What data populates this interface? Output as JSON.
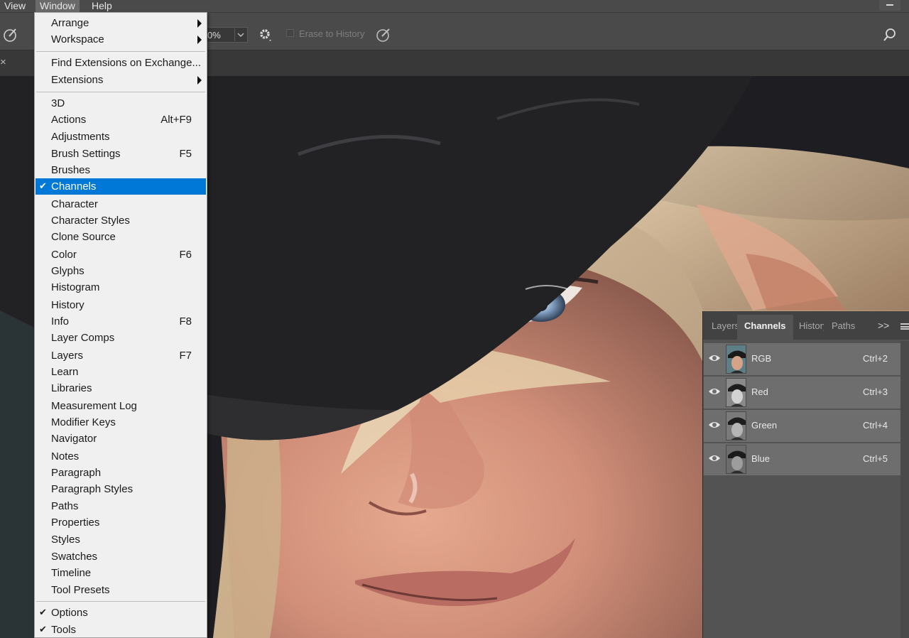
{
  "menubar": {
    "view": "View",
    "window": "Window",
    "help": "Help"
  },
  "options_bar": {
    "zoom_value": "0%",
    "erase_to_history": "Erase to History"
  },
  "tab_close": "×",
  "window_menu": {
    "group1": [
      {
        "label": "Arrange",
        "submenu": true
      },
      {
        "label": "Workspace",
        "submenu": true
      }
    ],
    "group2": [
      {
        "label": "Find Extensions on Exchange...",
        "submenu": false
      },
      {
        "label": "Extensions",
        "submenu": true
      }
    ],
    "items": [
      {
        "label": "3D",
        "shortcut": ""
      },
      {
        "label": "Actions",
        "shortcut": "Alt+F9"
      },
      {
        "label": "Adjustments",
        "shortcut": ""
      },
      {
        "label": "Brush Settings",
        "shortcut": "F5"
      },
      {
        "label": "Brushes",
        "shortcut": ""
      },
      {
        "label": "Channels",
        "shortcut": "",
        "checked": true,
        "highlighted": true
      },
      {
        "label": "Character",
        "shortcut": ""
      },
      {
        "label": "Character Styles",
        "shortcut": ""
      },
      {
        "label": "Clone Source",
        "shortcut": ""
      },
      {
        "label": "Color",
        "shortcut": "F6"
      },
      {
        "label": "Glyphs",
        "shortcut": ""
      },
      {
        "label": "Histogram",
        "shortcut": ""
      },
      {
        "label": "History",
        "shortcut": ""
      },
      {
        "label": "Info",
        "shortcut": "F8"
      },
      {
        "label": "Layer Comps",
        "shortcut": ""
      },
      {
        "label": "Layers",
        "shortcut": "F7"
      },
      {
        "label": "Learn",
        "shortcut": ""
      },
      {
        "label": "Libraries",
        "shortcut": ""
      },
      {
        "label": "Measurement Log",
        "shortcut": ""
      },
      {
        "label": "Modifier Keys",
        "shortcut": ""
      },
      {
        "label": "Navigator",
        "shortcut": ""
      },
      {
        "label": "Notes",
        "shortcut": ""
      },
      {
        "label": "Paragraph",
        "shortcut": ""
      },
      {
        "label": "Paragraph Styles",
        "shortcut": ""
      },
      {
        "label": "Paths",
        "shortcut": ""
      },
      {
        "label": "Properties",
        "shortcut": ""
      },
      {
        "label": "Styles",
        "shortcut": ""
      },
      {
        "label": "Swatches",
        "shortcut": ""
      },
      {
        "label": "Timeline",
        "shortcut": ""
      },
      {
        "label": "Tool Presets",
        "shortcut": ""
      }
    ],
    "group4": [
      {
        "label": "Options",
        "checked": true
      },
      {
        "label": "Tools",
        "checked": true
      }
    ],
    "check_mark": "✔"
  },
  "channels_panel": {
    "tabs": [
      "Layers",
      "Channels",
      "History",
      "Paths"
    ],
    "active_tab": "Channels",
    "more": ">>",
    "channels": [
      {
        "name": "RGB",
        "shortcut": "Ctrl+2"
      },
      {
        "name": "Red",
        "shortcut": "Ctrl+3"
      },
      {
        "name": "Green",
        "shortcut": "Ctrl+4"
      },
      {
        "name": "Blue",
        "shortcut": "Ctrl+5"
      }
    ]
  },
  "colors": {
    "menu_highlight": "#0078d7",
    "panel_bg": "#535353",
    "chrome_bg": "#4a4a4a"
  }
}
